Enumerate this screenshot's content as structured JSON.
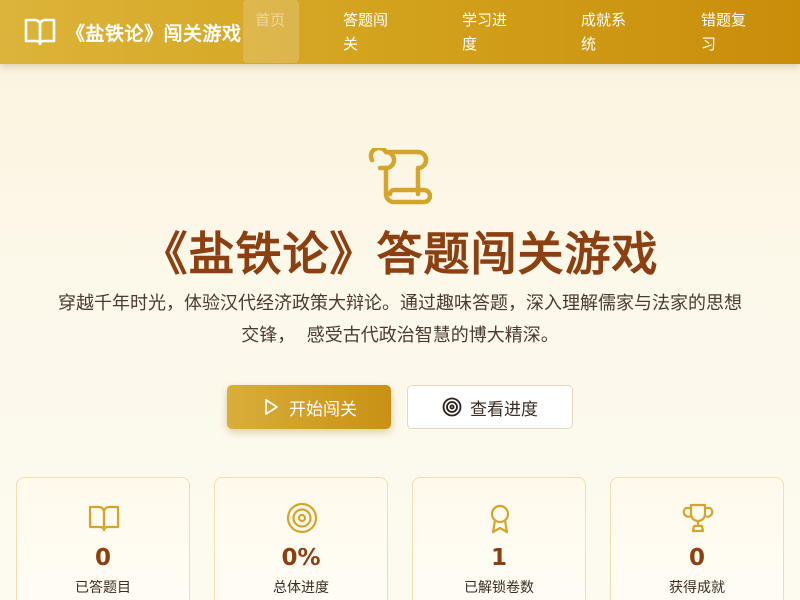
{
  "header": {
    "brand_icon": "open-book-icon",
    "title": "《盐铁论》闯关游戏",
    "nav": [
      {
        "label": "首页",
        "active": true
      },
      {
        "label": "答题闯关",
        "active": false
      },
      {
        "label": "学习进度",
        "active": false
      },
      {
        "label": "成就系统",
        "active": false
      },
      {
        "label": "错题复习",
        "active": false
      }
    ]
  },
  "hero": {
    "icon": "scroll-icon",
    "title": "《盐铁论》答题闯关游戏",
    "subtitle_line1": "穿越千年时光，体验汉代经济政策大辩论。通过趣味答题，深入理解儒家与法家的思想",
    "subtitle_line2": "交锋，  感受古代政治智慧的博大精深。",
    "start_button": {
      "label": "开始闯关",
      "icon": "play-icon"
    },
    "progress_button": {
      "label": "查看进度",
      "icon": "target-icon"
    }
  },
  "stats": [
    {
      "icon": "book-icon",
      "value": "0",
      "label": "已答题目"
    },
    {
      "icon": "target-icon",
      "value": "0%",
      "label": "总体进度"
    },
    {
      "icon": "award-icon",
      "value": "1",
      "label": "已解锁卷数"
    },
    {
      "icon": "trophy-icon",
      "value": "0",
      "label": "获得成就"
    }
  ],
  "colors": {
    "header_gold": "#d3a21c",
    "accent_brown": "#8c3f10",
    "icon_gold": "#d4a52a"
  }
}
